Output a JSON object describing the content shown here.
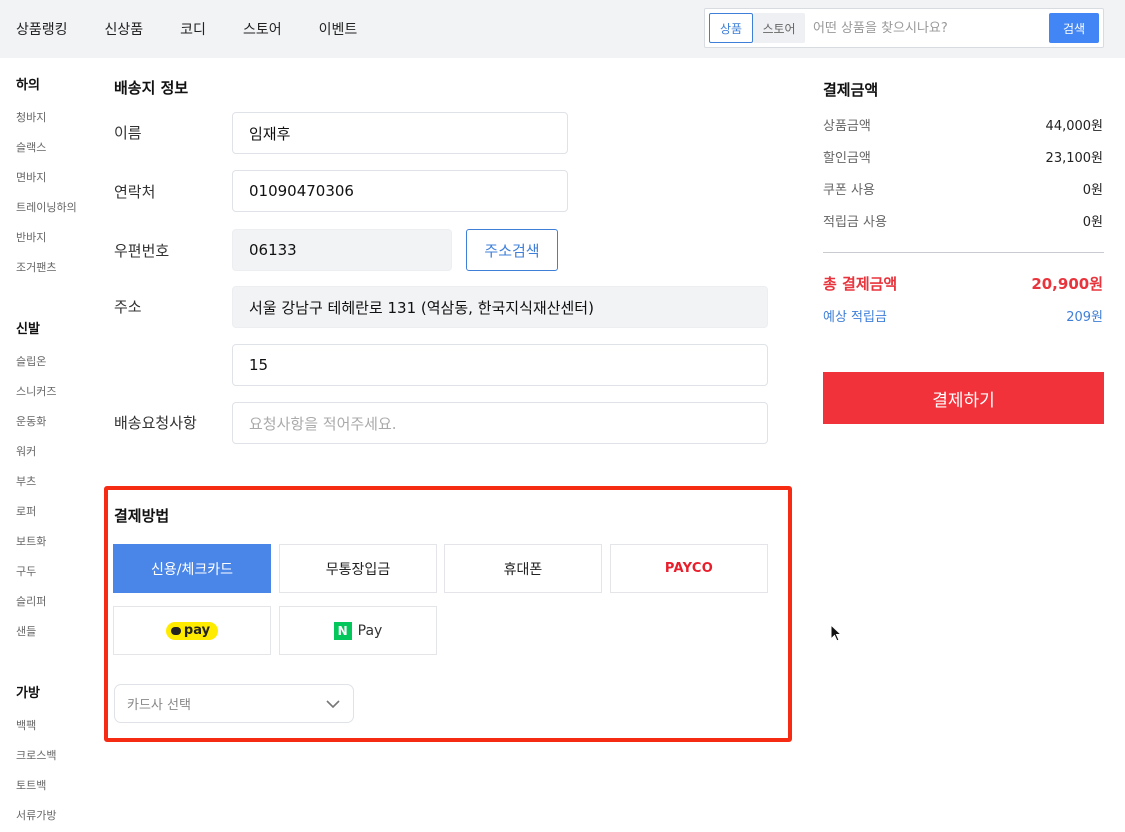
{
  "nav": {
    "items": [
      "상품랭킹",
      "신상품",
      "코디",
      "스토어",
      "이벤트"
    ]
  },
  "search": {
    "tab_product": "상품",
    "tab_store": "스토어",
    "placeholder": "어떤 상품을 찾으시나요?",
    "button": "검색"
  },
  "sidebar": {
    "categories": [
      {
        "title": "하의",
        "items": [
          "청바지",
          "슬랙스",
          "면바지",
          "트레이닝하의",
          "반바지",
          "조거팬츠"
        ]
      },
      {
        "title": "신발",
        "items": [
          "슬립온",
          "스니커즈",
          "운동화",
          "워커",
          "부츠",
          "로퍼",
          "보트화",
          "구두",
          "슬리퍼",
          "샌들"
        ]
      },
      {
        "title": "가방",
        "items": [
          "백팩",
          "크로스백",
          "토트백",
          "서류가방"
        ]
      }
    ]
  },
  "shipping": {
    "title": "배송지 정보",
    "name_label": "이름",
    "name_value": "임재후",
    "phone_label": "연락처",
    "phone_value": "01090470306",
    "zip_label": "우편번호",
    "zip_value": "06133",
    "address_search_button": "주소검색",
    "address_label": "주소",
    "address_value": "서울 강남구 테헤란로 131 (역삼동, 한국지식재산센터)",
    "address_detail_value": "15",
    "request_label": "배송요청사항",
    "request_placeholder": "요청사항을 적어주세요."
  },
  "payment": {
    "title": "결제방법",
    "options": {
      "card": "신용/체크카드",
      "bank": "무통장입금",
      "phone": "휴대폰",
      "payco": "PAYCO",
      "kakaopay": "pay",
      "npay": "Pay"
    },
    "npay_logo_letter": "N",
    "card_select_placeholder": "카드사 선택"
  },
  "summary": {
    "title": "결제금액",
    "rows": [
      {
        "label": "상품금액",
        "value": "44,000원"
      },
      {
        "label": "할인금액",
        "value": "23,100원"
      },
      {
        "label": "쿠폰 사용",
        "value": "0원"
      },
      {
        "label": "적립금 사용",
        "value": "0원"
      }
    ],
    "total_label": "총 결제금액",
    "total_value": "20,900원",
    "points_label": "예상 적립금",
    "points_value": "209원",
    "checkout_button": "결제하기"
  },
  "colors": {
    "accent_blue": "#4a86e8",
    "checkout_red": "#f1323a",
    "highlight_border": "#f52c13"
  }
}
